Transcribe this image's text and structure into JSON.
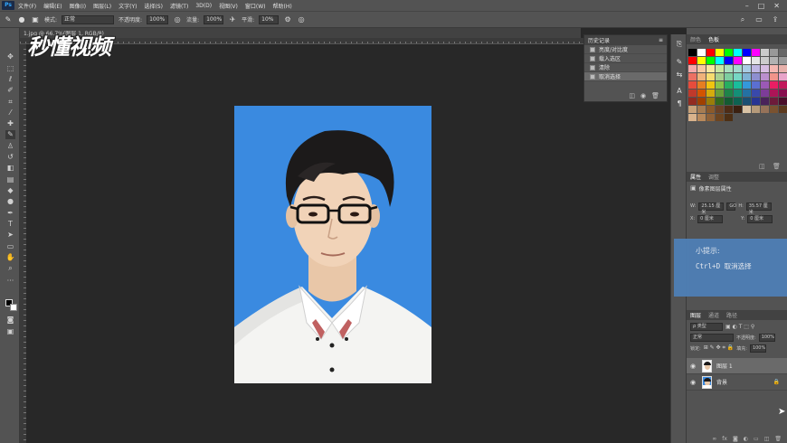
{
  "menubar": {
    "logo": "Ps",
    "items": [
      "文件(F)",
      "编辑(E)",
      "图像(I)",
      "图层(L)",
      "文字(Y)",
      "选择(S)",
      "滤镜(T)",
      "3D(D)",
      "视图(V)",
      "窗口(W)",
      "帮助(H)"
    ]
  },
  "options": {
    "mode_label": "模式:",
    "mode_value": "正常",
    "opacity_label": "不透明度:",
    "opacity_value": "100%",
    "flow_label": "流量:",
    "flow_value": "100%",
    "smooth_label": "平滑:",
    "smooth_value": "10%"
  },
  "document": {
    "tab_label": "1.jpg @ 66.7%(图层 1, RGB/8)"
  },
  "watermark": "秒懂视频",
  "history": {
    "title": "历史记录",
    "items": [
      "亮度/对比度",
      "载入选区",
      "清除",
      "取消选择"
    ]
  },
  "swatches_panel": {
    "tab_color": "颜色",
    "tab_swatches": "色板",
    "colors": [
      "#000000",
      "#ffffff",
      "#ff0000",
      "#ffff00",
      "#00ff00",
      "#00ffff",
      "#0000ff",
      "#ff00ff",
      "#cccccc",
      "#999999",
      "#666666",
      "#ff0000",
      "#ffff00",
      "#00ff00",
      "#00ffff",
      "#0000ff",
      "#ff00ff",
      "#ffffff",
      "#e5e5e5",
      "#cccccc",
      "#b2b2b2",
      "#999999",
      "#f5a9a9",
      "#f7c8a0",
      "#f9e79f",
      "#c8e6a0",
      "#a9dfbf",
      "#a2d9ce",
      "#a9cce3",
      "#bfb6e3",
      "#d7bde2",
      "#f5b7b1",
      "#e6b0aa",
      "#ec7063",
      "#f0b27a",
      "#f7dc6f",
      "#a9d18e",
      "#7dcea0",
      "#76d7c4",
      "#7fb3d5",
      "#8e8fd0",
      "#bb8fce",
      "#f1948a",
      "#e8a4c9",
      "#e74c3c",
      "#e67e22",
      "#f1c40f",
      "#8bc34a",
      "#27ae60",
      "#1abc9c",
      "#3498db",
      "#5b6fd1",
      "#9b59b6",
      "#e91e63",
      "#c2185b",
      "#c0392b",
      "#d35400",
      "#d4ac0d",
      "#689f38",
      "#1e8449",
      "#148f77",
      "#2471a3",
      "#3949ab",
      "#7d3c98",
      "#ad1457",
      "#880e4f",
      "#922b21",
      "#a04000",
      "#9a7d0a",
      "#33691e",
      "#145a32",
      "#0e6251",
      "#1b4f72",
      "#283593",
      "#4a235a",
      "#6d1b3a",
      "#4a0e2a",
      "#c8a27a",
      "#a67c52",
      "#8b5a2b",
      "#6b4226",
      "#4e2c16",
      "#3b2010",
      "#d9c3a5",
      "#b59a7a",
      "#967259",
      "#7a5230",
      "#5c3a1e",
      "#d9b38c",
      "#b8895b",
      "#8f6137",
      "#6d4520",
      "#4d2f14"
    ]
  },
  "properties": {
    "tab_properties": "属性",
    "tab_adjust": "调整",
    "kind_label": "像素图层属性",
    "w_label": "W:",
    "w_value": "25.15 厘米",
    "link_label": "GO",
    "h_label": "H:",
    "h_value": "35.57 厘米",
    "x_label": "X:",
    "x_value": "0 厘米",
    "y_label": "Y:",
    "y_value": "0 厘米"
  },
  "tip": {
    "title": "小提示:",
    "text": "Ctrl+D 取消选择"
  },
  "layers": {
    "tab_layers": "图层",
    "tab_channels": "通道",
    "tab_paths": "路径",
    "filter_label": "ρ 类型",
    "blend_mode": "正常",
    "opacity_label": "不透明度:",
    "opacity_value": "100%",
    "lock_label": "锁定:",
    "fill_label": "填充:",
    "fill_value": "100%",
    "items": [
      {
        "name": "图层 1",
        "selected": true
      },
      {
        "name": "背景",
        "selected": false
      }
    ]
  }
}
